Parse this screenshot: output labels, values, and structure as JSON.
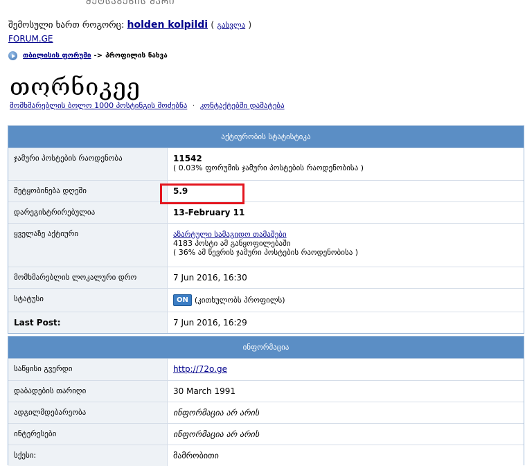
{
  "header": {
    "logo_text": "ᲛᲔᲢᲡᲐᲑᲔᲬᲘᲡ ᲛᲐᲠᲘ",
    "login_prefix": "შემოსული ხართ როგორც:",
    "username": "holden kolpildi",
    "logout_open": "(",
    "logout_label": "გასვლა",
    "logout_close": ")",
    "site_link": "FORUM.GE"
  },
  "breadcrumb": {
    "root": "თბილისის ფორუმი",
    "separator": "->",
    "current": "პროფილის ნახვა"
  },
  "profile": {
    "name": "თორნიკეე",
    "link_posts": "მომხმარებლის ბოლო 1000 პოსტინგის მოძებნა",
    "link_separator": "·",
    "link_contacts": "კონტაქტებში დამატება"
  },
  "stats": {
    "title": "აქტიურობის სტატისტიკა",
    "rows": [
      {
        "label": "ჯამური პოსტების რაოდენობა",
        "value": "11542",
        "sub": "( 0.03% ფორუმის ჯამური პოსტების რაოდენობისა )"
      },
      {
        "label": "შეტყობინება დღეში",
        "value": "5.9"
      },
      {
        "label": "დარეგისტრირებულია",
        "value": "13-February 11"
      },
      {
        "label": "ყველაზე აქტიური",
        "value_link": "აზარტული სამაგიდო თამაშები",
        "line2": "4183 პოსტი ამ განყოფილებაში",
        "line3": "( 36% ამ წევრის ჯამური პოსტების რაოდენობისა )"
      },
      {
        "label": "მომხმარებლის ლოკალური დრო",
        "value": "7 Jun 2016, 16:30"
      },
      {
        "label": "სტატუსი",
        "badge": "ON",
        "value": "(კითხულობს პროფილს)"
      },
      {
        "label": "Last Post:",
        "value": "7 Jun 2016, 16:29"
      }
    ]
  },
  "info": {
    "title": "ინფორმაცია",
    "rows": [
      {
        "label": "საწყისი გვერდი",
        "value": "http://72o.ge"
      },
      {
        "label": "დაბადების თარიღი",
        "value": "30 March 1991"
      },
      {
        "label": "ადგილმდებარეობა",
        "value": "ინფორმაცია არ არის"
      },
      {
        "label": "ინტერესები",
        "value": "ინფორმაცია არ არის"
      },
      {
        "label": "სქესი:",
        "value": "მამრობითი"
      }
    ]
  },
  "colors": {
    "header_bar": "#5b8ec5",
    "label_bg": "#eef2f6",
    "link": "#00008b",
    "highlight": "#e3151e"
  }
}
